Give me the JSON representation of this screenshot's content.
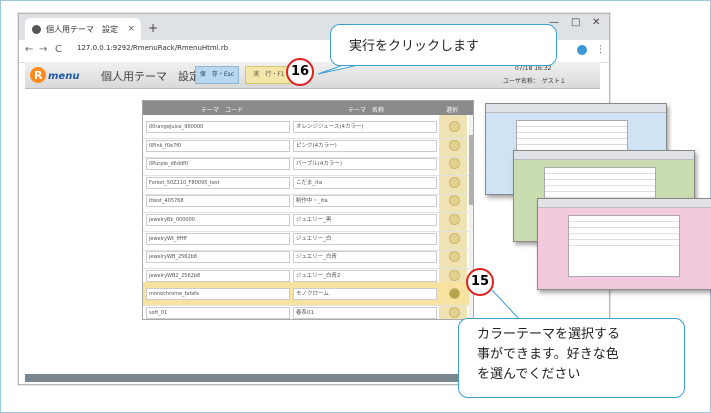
{
  "browser": {
    "tab_title": "個人用テーマ　設定",
    "tab_close": "×",
    "new_tab": "+",
    "minimize": "—",
    "maximize": "□",
    "close": "✕",
    "back": "←",
    "forward": "→",
    "reload": "C",
    "url": "127.0.0.1:9292/RmenuRack/RmenuHtml.rb",
    "menu": "⋮"
  },
  "app": {
    "title": "個人用テーマ　設定",
    "save_label": "保　存・Esc",
    "run_label": "実　行・F1",
    "header_right_line1": "07/18 16:32",
    "header_right_line2": "ユーザ名称：　ゲスト１"
  },
  "table": {
    "headers": [
      "テーマ　コード",
      "テーマ　名称",
      "選択"
    ],
    "rows": [
      {
        "code": "00rangeJuice_960000",
        "name": "オレンジジュース(4カラー)"
      },
      {
        "code": "0Pink_f0e7f0",
        "name": "ピンク(4カラー)"
      },
      {
        "code": "0Purple_d6ddf0",
        "name": "パープル(4カラー)"
      },
      {
        "code": "Forest_50Z110_F80095_test",
        "name": "こだま_ita"
      },
      {
        "code": "ittest_405768",
        "name": "制作中・_ita"
      },
      {
        "code": "jewelryBk_000000",
        "name": "ジュエリー_黒"
      },
      {
        "code": "jewelryWt_ffffff",
        "name": "ジュエリー_白"
      },
      {
        "code": "jewelryWB_2562b8",
        "name": "ジュエリー_白青"
      },
      {
        "code": "jewelryWB2_2562b8",
        "name": "ジュエリー_白青2"
      },
      {
        "code": "monochrome_fafafa",
        "name": "モノクローム"
      },
      {
        "code": "soft_01",
        "name": "春系01"
      }
    ]
  },
  "callouts": {
    "top": "実行をクリックします",
    "bottom_line1": "カラーテーマを選択する",
    "bottom_line2": "事ができます。好きな色",
    "bottom_line3": "を選んでください",
    "badge_run": "16",
    "badge_select": "15"
  },
  "colors": {
    "callout_border": "#3aa0d0",
    "badge_border": "#e02020",
    "selected_row": "#f7e2a0",
    "theme_blue": "#cfe3f5",
    "theme_green": "#c9dcb0",
    "theme_pink": "#f2c9dd"
  }
}
